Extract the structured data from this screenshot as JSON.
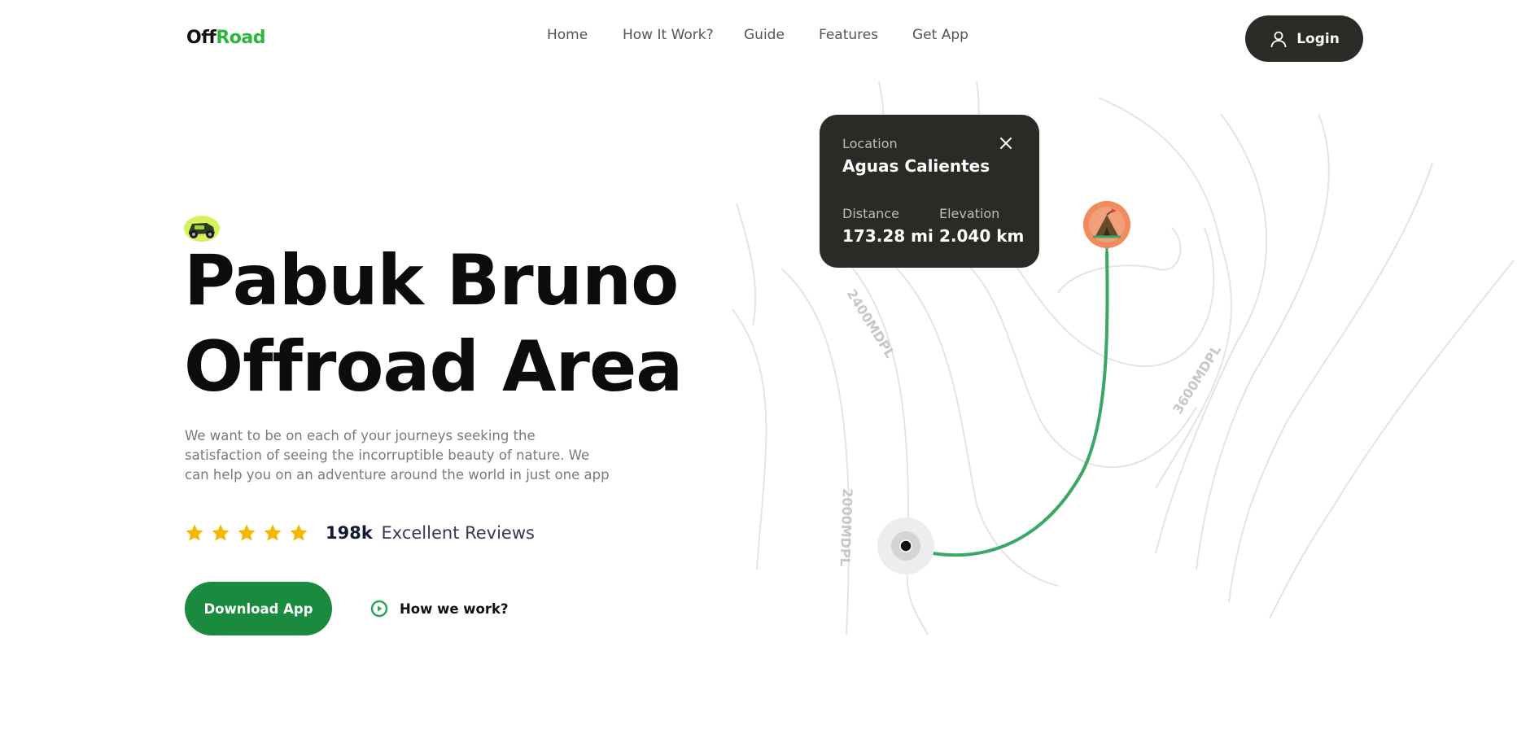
{
  "brand": {
    "part1": "Off",
    "part2": "Road"
  },
  "nav": {
    "items": [
      "Home",
      "How It Work?",
      "Guide",
      "Features",
      "Get App"
    ],
    "login_label": "Login"
  },
  "hero": {
    "title_line1": "Pabuk Bruno",
    "title_line2": "Offroad Area",
    "description": "We want to be on each of your journeys seeking the satisfaction of seeing the incorruptible beauty of nature. We can help you on an adventure around the world in just one app",
    "rating_stars": 5,
    "reviews_count": "198k",
    "reviews_label": "Excellent Reviews",
    "download_label": "Download App",
    "how_label": "How we work?"
  },
  "location_card": {
    "location_label": "Location",
    "location_name": "Aguas Calientes",
    "distance_label": "Distance",
    "distance_value": "173.28 mi",
    "elevation_label": "Elevation",
    "elevation_value": "2.040 km"
  },
  "map_labels": {
    "contour_a": "2400MDPL",
    "contour_b": "3600MDPL",
    "contour_c": "2000MDPL"
  },
  "colors": {
    "accent_green": "#198a3e",
    "route_green": "#3aa765",
    "brand_green": "#2bb53a",
    "dark": "#2a2b27",
    "star": "#f5b800",
    "pin": "#f08b5e"
  }
}
